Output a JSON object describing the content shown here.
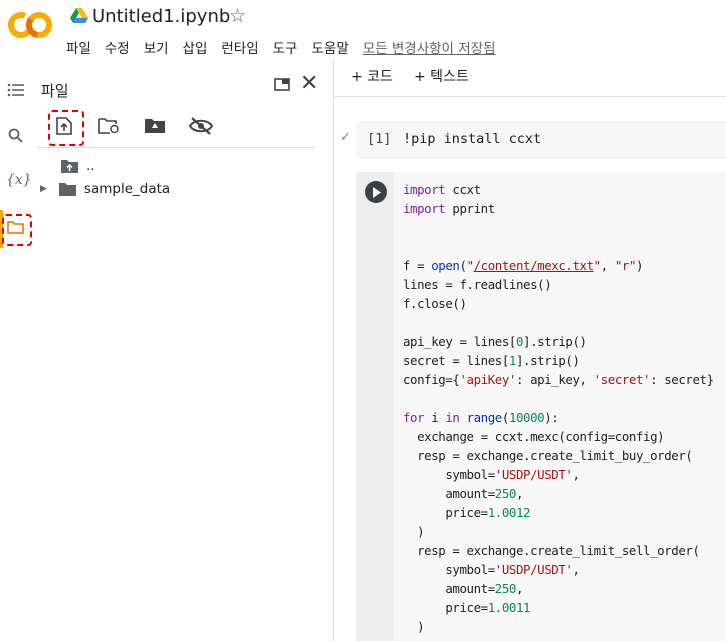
{
  "header": {
    "notebook_title": "Untitled1.ipynb",
    "menu": [
      "파일",
      "수정",
      "보기",
      "삽입",
      "런타임",
      "도구",
      "도움말"
    ],
    "save_status": "모든 변경사항이 저장됨"
  },
  "brand": {
    "logo_text": "CO",
    "accent": "#f9ab00",
    "accent2": "#e8710a"
  },
  "rail": {
    "icons": [
      "table-of-contents-icon",
      "search-icon",
      "variables-icon",
      "folder-icon"
    ],
    "variables_glyph": "{x}"
  },
  "file_panel": {
    "title": "파일",
    "tools": [
      "upload-icon",
      "refresh-folder-icon",
      "mount-drive-icon",
      "hide-files-icon"
    ],
    "tree": [
      {
        "label": "..",
        "type": "parent"
      },
      {
        "label": "sample_data",
        "type": "folder"
      }
    ]
  },
  "toolbar": {
    "add_code": "+ 코드",
    "add_text": "+ 텍스트"
  },
  "cells": {
    "cell1": {
      "exec_count": "[1]",
      "code": "!pip install ccxt"
    },
    "cell2": {
      "lines": [
        "import ccxt",
        "import pprint",
        "",
        "",
        "f = open(\"/content/mexc.txt\", \"r\")",
        "lines = f.readlines()",
        "f.close()",
        "",
        "api_key = lines[0].strip()",
        "secret = lines[1].strip()",
        "config={'apiKey': api_key, 'secret': secret}",
        "",
        "for i in range(10000):",
        "  exchange = ccxt.mexc(config=config)",
        "  resp = exchange.create_limit_buy_order(",
        "      symbol='USDP/USDT',",
        "      amount=250,",
        "      price=1.0012",
        "  )",
        "  resp = exchange.create_limit_sell_order(",
        "      symbol='USDP/USDT',",
        "      amount=250,",
        "      price=1.0011",
        "  )"
      ]
    }
  }
}
